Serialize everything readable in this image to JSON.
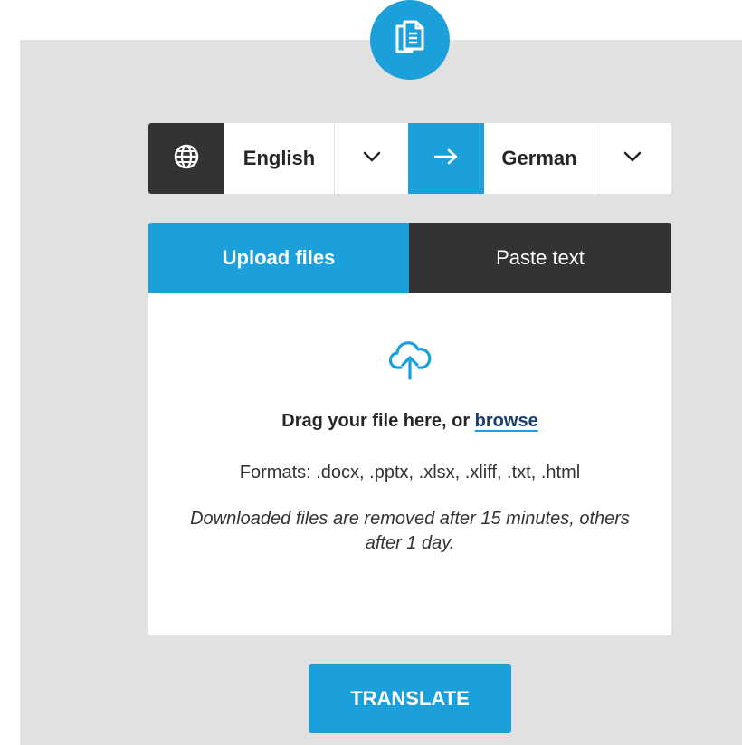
{
  "header": {
    "icon": "copy-documents-icon"
  },
  "language_bar": {
    "globe_icon": "globe-icon",
    "source_language": "English",
    "target_language": "German",
    "swap_icon": "arrow-right-icon",
    "dropdown_icon": "chevron-down-icon"
  },
  "tabs": [
    {
      "label": "Upload files",
      "active": true
    },
    {
      "label": "Paste text",
      "active": false
    }
  ],
  "upload": {
    "icon": "cloud-upload-icon",
    "drag_text": "Drag your file here, or ",
    "browse_label": "browse",
    "formats_text": "Formats: .docx, .pptx, .xlsx, .xliff, .txt, .html",
    "retention_text": "Downloaded files are removed after 15 minutes, others after 1 day."
  },
  "actions": {
    "translate_label": "TRANSLATE"
  },
  "colors": {
    "accent": "#1ba0db",
    "dark": "#333333",
    "panel_bg": "#e1e1e1"
  }
}
